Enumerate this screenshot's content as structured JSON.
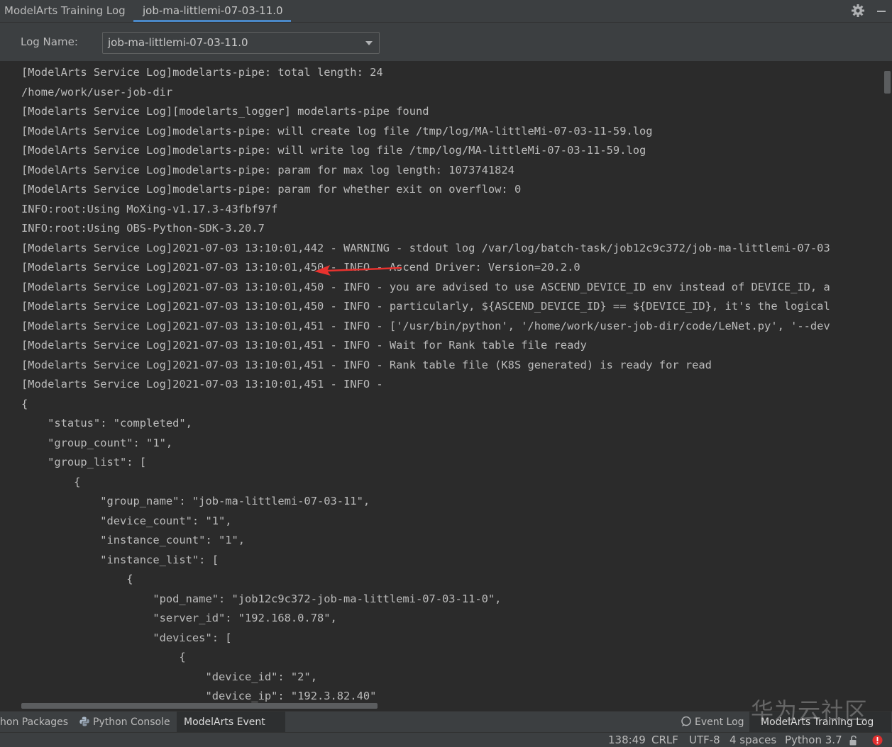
{
  "titlebar": {
    "app_tab": "ModelArts Training Log",
    "job_tab": "job-ma-littlemi-07-03-11.0",
    "settings_icon": "gear-icon",
    "minimize_icon": "minimize-icon"
  },
  "log_selector": {
    "label": "Log Name:",
    "selected": "job-ma-littlemi-07-03-11.0"
  },
  "console": {
    "lines": [
      "[ModelArts Service Log]modelarts-pipe: total length: 24",
      "/home/work/user-job-dir",
      "[Modelarts Service Log][modelarts_logger] modelarts-pipe found",
      "[ModelArts Service Log]modelarts-pipe: will create log file /tmp/log/MA-littleMi-07-03-11-59.log",
      "[ModelArts Service Log]modelarts-pipe: will write log file /tmp/log/MA-littleMi-07-03-11-59.log",
      "[ModelArts Service Log]modelarts-pipe: param for max log length: 1073741824",
      "[ModelArts Service Log]modelarts-pipe: param for whether exit on overflow: 0",
      "INFO:root:Using MoXing-v1.17.3-43fbf97f",
      "INFO:root:Using OBS-Python-SDK-3.20.7",
      "[Modelarts Service Log]2021-07-03 13:10:01,442 - WARNING - stdout log /var/log/batch-task/job12c9c372/job-ma-littlemi-07-03",
      "[Modelarts Service Log]2021-07-03 13:10:01,450 - INFO - Ascend Driver: Version=20.2.0",
      "[Modelarts Service Log]2021-07-03 13:10:01,450 - INFO - you are advised to use ASCEND_DEVICE_ID env instead of DEVICE_ID, a",
      "[Modelarts Service Log]2021-07-03 13:10:01,450 - INFO - particularly, ${ASCEND_DEVICE_ID} == ${DEVICE_ID}, it's the logical",
      "[Modelarts Service Log]2021-07-03 13:10:01,451 - INFO - ['/usr/bin/python', '/home/work/user-job-dir/code/LeNet.py', '--dev",
      "[Modelarts Service Log]2021-07-03 13:10:01,451 - INFO - Wait for Rank table file ready",
      "[Modelarts Service Log]2021-07-03 13:10:01,451 - INFO - Rank table file (K8S generated) is ready for read",
      "[Modelarts Service Log]2021-07-03 13:10:01,451 - INFO -",
      "{",
      "    \"status\": \"completed\",",
      "    \"group_count\": \"1\",",
      "    \"group_list\": [",
      "        {",
      "            \"group_name\": \"job-ma-littlemi-07-03-11\",",
      "            \"device_count\": \"1\",",
      "            \"instance_count\": \"1\",",
      "            \"instance_list\": [",
      "                {",
      "                    \"pod_name\": \"job12c9c372-job-ma-littlemi-07-03-11-0\",",
      "                    \"server_id\": \"192.168.0.78\",",
      "                    \"devices\": [",
      "                        {",
      "                            \"device_id\": \"2\",",
      "                            \"device_ip\": \"192.3.82.40\""
    ],
    "annotation": "red-arrow-annotation"
  },
  "tool_windows": {
    "packages": "hon Packages",
    "python_console": "Python Console",
    "event_log_modelarts": "ModelArts Event Log",
    "event_log": "Event Log",
    "training_log": "ModelArts Training Log"
  },
  "statusbar": {
    "position": "138:49",
    "line_sep": "CRLF",
    "encoding": "UTF-8",
    "indent": "4 spaces",
    "interpreter": "Python 3.7"
  },
  "watermark": "华为云社区",
  "colors": {
    "background": "#2b2b2b",
    "panel": "#3c3f41",
    "accent": "#4a88c7",
    "annotation": "#e8322e",
    "error": "#e03030"
  }
}
